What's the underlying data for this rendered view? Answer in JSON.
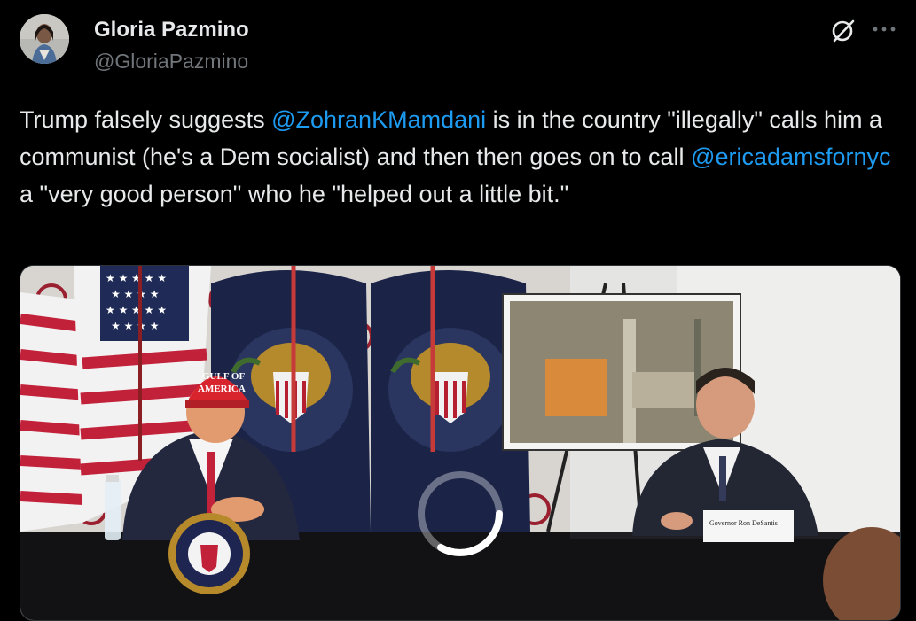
{
  "author": {
    "display_name": "Gloria Pazmino",
    "handle": "@GloriaPazmino"
  },
  "tweet": {
    "text_1": "Trump falsely suggests ",
    "mention_1": "@ZohranKMamdani",
    "text_2": " is in the country \"illegally\" calls him a communist (he's a Dem socialist) and then then goes on to call ",
    "mention_2": "@ericadamsfornyc",
    "text_3": " a \"very good person\" who he \"helped out a little bit.\""
  },
  "media": {
    "hat_text_1": "GULF OF",
    "hat_text_2": "AMERICA",
    "nameplate_text": "Governor Ron DeSantis",
    "seal_text": "PRESIDENT OF THE UNITED STATES",
    "loading": true
  },
  "icons": {
    "grok": "grok-icon",
    "more": "more-icon"
  },
  "colors": {
    "background": "#000000",
    "text": "#e7e9ea",
    "secondary": "#71767b",
    "link": "#1d9bf0"
  }
}
